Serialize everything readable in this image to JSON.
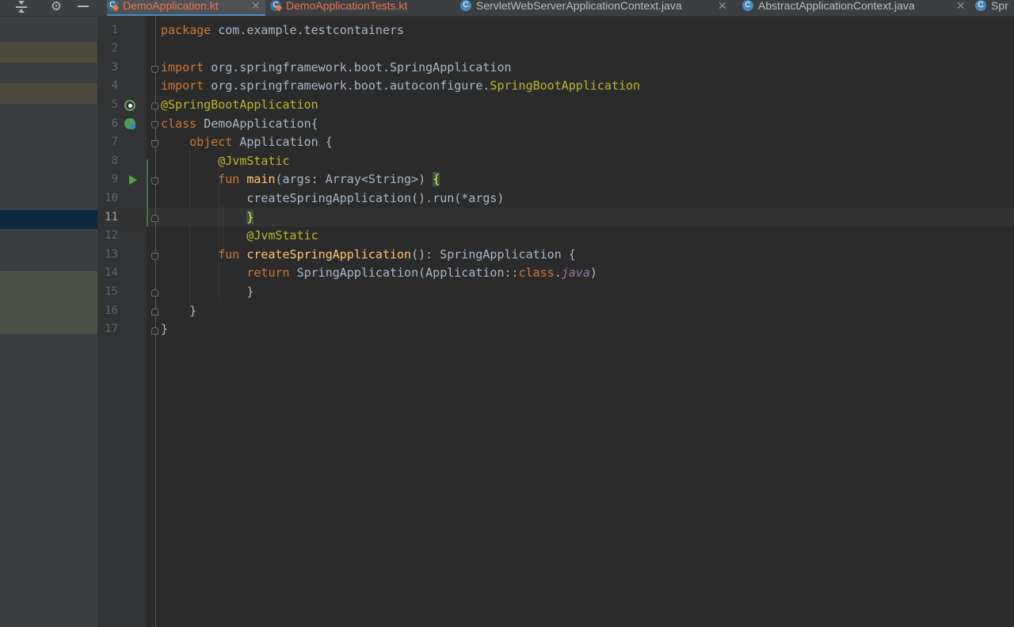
{
  "tabs": [
    {
      "label": "DemoApplication.kt",
      "icon": "kotlin-class-icon",
      "active": true,
      "has_close": true
    },
    {
      "label": "DemoApplicationTests.kt",
      "icon": "kotlin-test-icon",
      "active": false,
      "has_close": false
    },
    {
      "label": "ServletWebServerApplicationContext.java",
      "icon": "java-class-icon",
      "active": false,
      "has_close": true
    },
    {
      "label": "AbstractApplicationContext.java",
      "icon": "java-class-icon",
      "active": false,
      "has_close": true
    },
    {
      "label": "Spr",
      "icon": "java-class-icon",
      "active": false,
      "has_close": false
    }
  ],
  "toolbar": {
    "icons": [
      "collapse-all-icon",
      "gear-icon",
      "minimize-icon"
    ]
  },
  "editor": {
    "active_line": 11,
    "line_numbers": [
      "1",
      "2",
      "3",
      "4",
      "5",
      "6",
      "7",
      "8",
      "9",
      "10",
      "11",
      "12",
      "13",
      "14",
      "15",
      "16",
      "17"
    ],
    "lines": [
      {
        "segments": [
          [
            "kw",
            "package"
          ],
          [
            "",
            "com.example.testcontainers"
          ]
        ]
      },
      {
        "segments": []
      },
      {
        "segments": [
          [
            "kw",
            "import"
          ],
          [
            "",
            "org.springframework.boot.SpringApplication"
          ]
        ]
      },
      {
        "segments": [
          [
            "kw",
            "import"
          ],
          [
            "",
            "org.springframework.boot.autoconfigure."
          ],
          [
            "ann",
            "SpringBootApplication"
          ]
        ]
      },
      {
        "segments": [
          [
            "ann",
            "@SpringBootApplication"
          ]
        ]
      },
      {
        "segments": [
          [
            "kw",
            "class"
          ],
          [
            "",
            "DemoApplication{"
          ]
        ]
      },
      {
        "segments": [
          [
            "",
            "    "
          ],
          [
            "kw",
            "object"
          ],
          [
            "",
            "Application {"
          ]
        ]
      },
      {
        "segments": [
          [
            "",
            "        "
          ],
          [
            "ann",
            "@JvmStatic"
          ]
        ]
      },
      {
        "segments": [
          [
            "",
            "        "
          ],
          [
            "kw",
            "fun"
          ],
          [
            "fn",
            "main"
          ],
          [
            "",
            "(args: Array<String>) "
          ],
          [
            "brace-hl",
            "{"
          ]
        ]
      },
      {
        "segments": [
          [
            "",
            "            createSpringApplication().run(*args)"
          ]
        ]
      },
      {
        "segments": [
          [
            "",
            "            "
          ],
          [
            "brace-hl",
            "}"
          ]
        ]
      },
      {
        "segments": [
          [
            "",
            "            "
          ],
          [
            "ann",
            "@JvmStatic"
          ]
        ]
      },
      {
        "segments": [
          [
            "",
            "        "
          ],
          [
            "kw",
            "fun"
          ],
          [
            "fn",
            "createSpringApplication"
          ],
          [
            "",
            "(): SpringApplication {"
          ]
        ]
      },
      {
        "segments": [
          [
            "",
            "            "
          ],
          [
            "kw",
            "return"
          ],
          [
            "",
            "SpringApplication(Application::"
          ],
          [
            "kw",
            "class"
          ],
          [
            "",
            "."
          ],
          [
            "it",
            "java"
          ],
          [
            "",
            ")"
          ]
        ]
      },
      {
        "segments": [
          [
            "",
            "            }"
          ]
        ]
      },
      {
        "segments": [
          [
            "",
            "    }"
          ]
        ]
      },
      {
        "segments": [
          [
            "",
            "}"
          ]
        ]
      }
    ],
    "gutter_icons": {
      "5": "spring-bean-icon",
      "6": "spring-class-icon",
      "9": "run-icon"
    }
  },
  "colors": {
    "background": "#2b2b2b",
    "keyword": "#cc7832",
    "annotation": "#bbb529",
    "function": "#ffc66d",
    "text": "#a9b7c6",
    "active_tab_label": "#e8714f"
  }
}
